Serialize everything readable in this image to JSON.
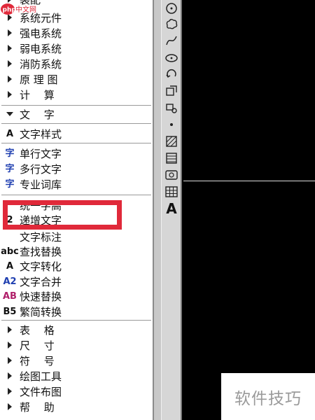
{
  "logo": {
    "text": "php中文网",
    "badge": "php",
    "name": "中文网"
  },
  "menu": {
    "partial_top": "装配",
    "groups_top": [
      {
        "label": "系统元件"
      },
      {
        "label": "强电系统"
      },
      {
        "label": "弱电系统"
      },
      {
        "label": "消防系统"
      },
      {
        "label": "原 理 图"
      },
      {
        "label": "计　 算"
      }
    ],
    "expanded": {
      "label": "文　 字"
    },
    "text_items": [
      {
        "icon": "text-style-icon",
        "glyph": "A",
        "label": "文字样式"
      },
      {
        "icon": "single-line-text-icon",
        "glyph": "字",
        "label": "单行文字"
      },
      {
        "icon": "multi-line-text-icon",
        "glyph": "字",
        "label": "多行文字"
      },
      {
        "icon": "professional-vocabulary-icon",
        "glyph": "字",
        "label": "专业词库"
      },
      {
        "icon": "special-character-icon",
        "glyph": "",
        "label": "统一字高"
      },
      {
        "icon": "increment-text-icon",
        "glyph": "2",
        "label": "递增文字"
      },
      {
        "icon": "text-mark-icon",
        "glyph": "",
        "label": "文字标注"
      },
      {
        "icon": "find-replace-icon",
        "glyph": "abc",
        "label": "查找替换"
      },
      {
        "icon": "text-convert-icon",
        "glyph": "A",
        "label": "文字转化"
      },
      {
        "icon": "text-merge-icon",
        "glyph": "A2",
        "label": "文字合并"
      },
      {
        "icon": "quick-replace-icon",
        "glyph": "AB",
        "label": "快速替换"
      },
      {
        "icon": "simplified-traditional-icon",
        "glyph": "B5",
        "label": "繁简转换"
      }
    ],
    "groups_bottom": [
      {
        "label": "表　 格"
      },
      {
        "label": "尺　 寸"
      },
      {
        "label": "符　 号"
      },
      {
        "label": "绘图工具"
      },
      {
        "label": "文件布图"
      },
      {
        "label": "帮　 助"
      }
    ]
  },
  "toolbar": {
    "tools": [
      "circle-tool-icon",
      "cloud-tool-icon",
      "spline-tool-icon",
      "ellipse-tool-icon",
      "rotate-tool-icon",
      "copy-tool-icon",
      "move-tool-icon",
      "point-tool-icon",
      "hatch-tool-icon",
      "gradient-hatch-tool-icon",
      "boundary-tool-icon",
      "table-tool-icon",
      "multiline-text-tool-icon"
    ],
    "text_tool_glyph": "A"
  },
  "watermark": {
    "text": "软件技巧"
  },
  "colors": {
    "highlight": "#e0293a",
    "canvas": "#000000",
    "panel": "#ffffff",
    "toolbar": "#d6d6d6"
  }
}
